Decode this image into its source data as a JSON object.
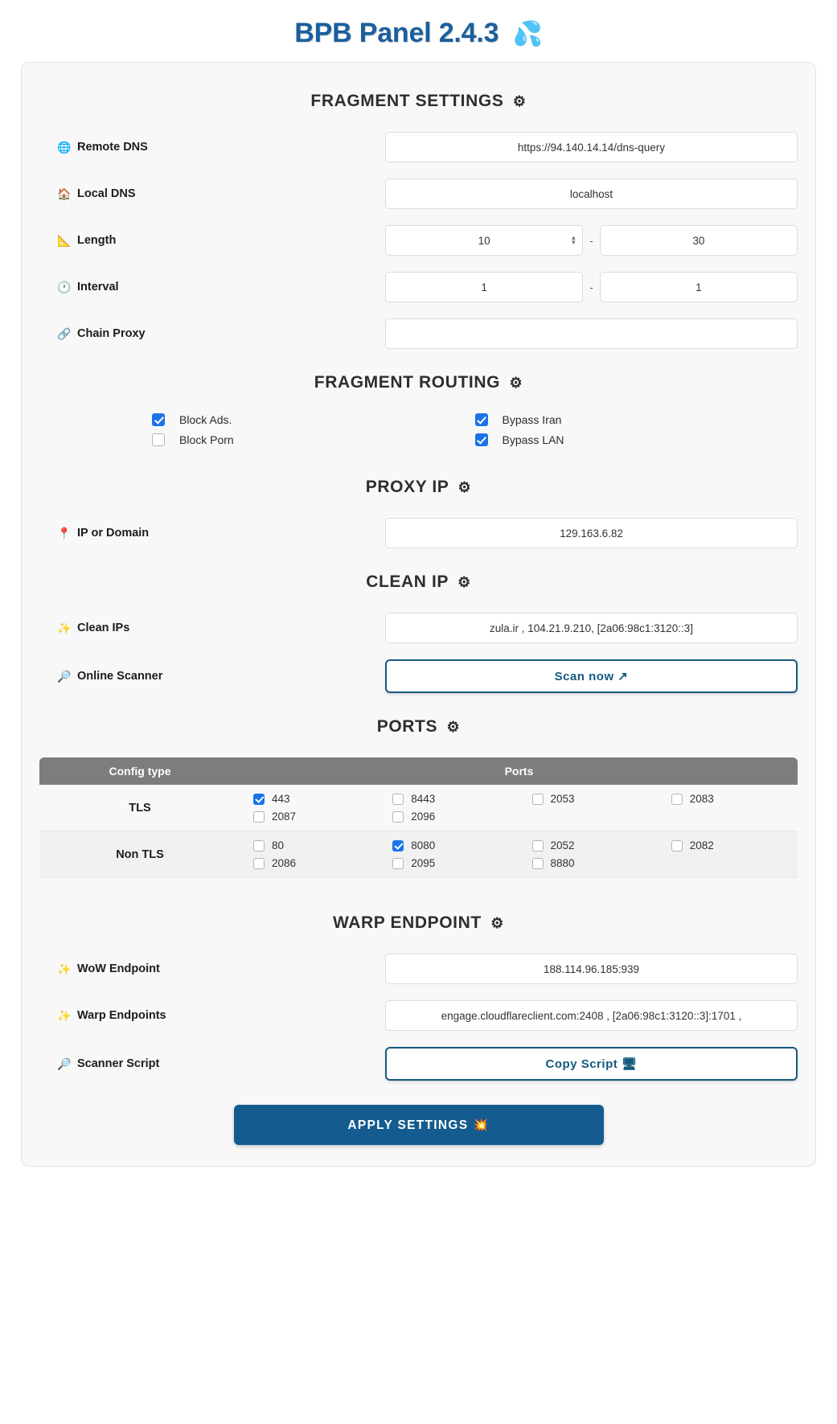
{
  "header": {
    "title": "BPB Panel",
    "version": "2.4.3",
    "logo_icon": "droplets-icon",
    "logo_glyph": "💦"
  },
  "gear_glyph": "⚙",
  "sections": {
    "fragment_settings": {
      "title": "FRAGMENT SETTINGS",
      "fields": {
        "remote_dns": {
          "label": "Remote DNS",
          "icon": "globe-icon",
          "glyph": "🌐",
          "value": "https://94.140.14.14/dns-query"
        },
        "local_dns": {
          "label": "Local DNS",
          "icon": "house-icon",
          "glyph": "🏠",
          "value": "localhost"
        },
        "length": {
          "label": "Length",
          "icon": "ruler-icon",
          "glyph": "📐",
          "min": "10",
          "max": "30",
          "separator": "-"
        },
        "interval": {
          "label": "Interval",
          "icon": "clock-icon",
          "glyph": "🕐",
          "min": "1",
          "max": "1",
          "separator": "-"
        },
        "chain_proxy": {
          "label": "Chain Proxy",
          "icon": "link-icon",
          "glyph": "🔗",
          "value": ""
        }
      }
    },
    "fragment_routing": {
      "title": "FRAGMENT ROUTING",
      "left_options": [
        {
          "label": "Block Ads.",
          "checked": true
        },
        {
          "label": "Block Porn",
          "checked": false
        }
      ],
      "right_options": [
        {
          "label": "Bypass Iran",
          "checked": true
        },
        {
          "label": "Bypass LAN",
          "checked": true
        }
      ]
    },
    "proxy_ip": {
      "title": "PROXY IP",
      "field": {
        "label": "IP or Domain",
        "icon": "pin-icon",
        "glyph": "📍",
        "value": "129.163.6.82"
      }
    },
    "clean_ip": {
      "title": "CLEAN IP",
      "clean_ips": {
        "label": "Clean IPs",
        "icon": "sparkles-icon",
        "glyph": "✨",
        "value": "zula.ir , 104.21.9.210, [2a06:98c1:3120::3]"
      },
      "online_scanner": {
        "label": "Online Scanner",
        "icon": "magnifier-icon",
        "glyph": "🔎",
        "button_label": "Scan now",
        "button_icon": "external-link-icon",
        "button_glyph": "↗"
      }
    },
    "ports": {
      "title": "PORTS",
      "columns": [
        "Config type",
        "Ports"
      ],
      "rows": [
        {
          "type": "TLS",
          "ports": [
            {
              "port": "443",
              "checked": true
            },
            {
              "port": "8443",
              "checked": false
            },
            {
              "port": "2053",
              "checked": false
            },
            {
              "port": "2083",
              "checked": false
            },
            {
              "port": "2087",
              "checked": false
            },
            {
              "port": "2096",
              "checked": false
            }
          ]
        },
        {
          "type": "Non TLS",
          "ports": [
            {
              "port": "80",
              "checked": false
            },
            {
              "port": "8080",
              "checked": true
            },
            {
              "port": "2052",
              "checked": false
            },
            {
              "port": "2082",
              "checked": false
            },
            {
              "port": "2086",
              "checked": false
            },
            {
              "port": "2095",
              "checked": false
            },
            {
              "port": "8880",
              "checked": false
            }
          ]
        }
      ]
    },
    "warp_endpoint": {
      "title": "WARP ENDPOINT",
      "wow_endpoint": {
        "label": "WoW Endpoint",
        "icon": "sparkles-icon",
        "glyph": "✨",
        "value": "188.114.96.185:939"
      },
      "warp_endpoints": {
        "label": "Warp Endpoints",
        "icon": "sparkles-icon",
        "glyph": "✨",
        "value": "engage.cloudflareclient.com:2408 , [2a06:98c1:3120::3]:1701 ,"
      },
      "scanner_script": {
        "label": "Scanner Script",
        "icon": "magnifier-icon",
        "glyph": "🔎",
        "button_label": "Copy Script",
        "button_icon": "terminal-icon",
        "button_glyph": "🖥"
      }
    }
  },
  "apply": {
    "label": "APPLY SETTINGS",
    "icon": "boom-icon",
    "glyph": "💥"
  },
  "colors": {
    "accent": "#145c8f",
    "title": "#1a5f9e",
    "checkbox_on": "#1a73e8",
    "table_header": "#7d7d7d"
  }
}
